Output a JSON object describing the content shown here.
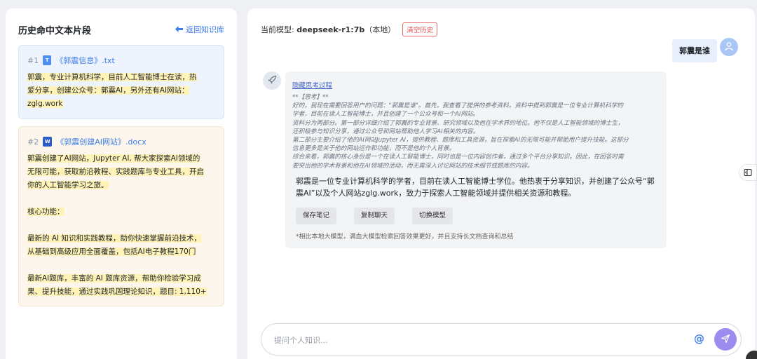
{
  "left": {
    "title": "历史命中文本片段",
    "back_label": "返回知识库",
    "snippets": [
      {
        "num": "#1",
        "name": "《郭震信息》.txt",
        "lines": [
          "郭震，专业计算机科学，目前人工智能博士在读，热",
          "爱分享，创建公众号：郭震AI，另外还有AI网站：",
          "zglg.work"
        ]
      },
      {
        "num": "#2",
        "name": "《郭震创建AI网站》.docx",
        "lines": [
          "郭震创建了AI网站，Jupyter AI, 帮大家探索AI领域的",
          "无限可能，获取前沿教程、实践题库与专业工具，开启",
          "你的人工智能学习之旅。",
          "核心功能：",
          "最新的 AI 知识和实践教程，助你快速掌握前沿技术，",
          "从基础到高级应用全面覆盖，包括AI电子教程170门",
          "最新AI题库，丰富的 AI 题库资源，帮助你检验学习成",
          "果、提升技能，通过实践巩固理论知识，题目: 1,110+"
        ]
      }
    ]
  },
  "right": {
    "model_prefix": "当前模型: ",
    "model_name": "deepseek-r1:7b",
    "model_suffix": "（本地）",
    "clear_label": "清空历史",
    "user_message": "郭震是谁",
    "toggle_think": "隐藏思考过程",
    "think_lines": [
      "**【思考】**",
      "好的，我现在需要回答用户的问题：\"郭震是谁\"。首先，我查看了提供的参考资料。资料中提到郭震是一位专业计算机科学的",
      "学者，目前在读人工智能博士，并且创建了一个公众号和一个AI网站。",
      "资料分为两部分。第一部分详细介绍了郭震的专业背景、研究领域以及他在学术界的地位。他不仅是人工智能领域的博士生，",
      "还积极参与知识分享，通过公众号和网站帮助他人学习AI相关的内容。",
      "第二部分主要介绍了他的AI网站Jupyter AI，提供教程、题库和工具资源，旨在探索AI的无限可能并帮助用户提升技能。这部分",
      "信息更多是关于他的网站运作和功能，而不是他的个人背景。",
      "综合来看，郭震的核心身份是一个在读人工智能博士，同时也是一位内容创作者，通过多个平台分享知识。因此，在回答时需",
      "要突出他的学术背景和他在AI领域的活动，而无需深入讨论网站的技术细节或题库的内容。"
    ],
    "answer_lines": [
      "郭震是一位专业计算机科学的学者，目前在读人工智能博士学位。他热衷于分享知识，并创建了公众号“郭",
      "震AI”以及个人网站zglg.work，致力于探索人工智能领域并提供相关资源和教程。"
    ],
    "actions": [
      "保存笔记",
      "复制聊天",
      "切换模型"
    ],
    "footnote": "*相比本地大模型，满血大模型检索回答效果更好，并且支持长文档查询和总结",
    "input_placeholder": "提问个人知识...",
    "at_symbol": "@"
  },
  "colors": {
    "accent": "#3d7eea",
    "send": "#9b8cf0",
    "highlight": "#fff3b8",
    "danger": "#e04848"
  },
  "icons": [
    "arrow-left-icon",
    "txt-file-icon",
    "word-file-icon",
    "user-icon",
    "rocket-icon",
    "sidebar-toggle-icon",
    "send-icon"
  ]
}
